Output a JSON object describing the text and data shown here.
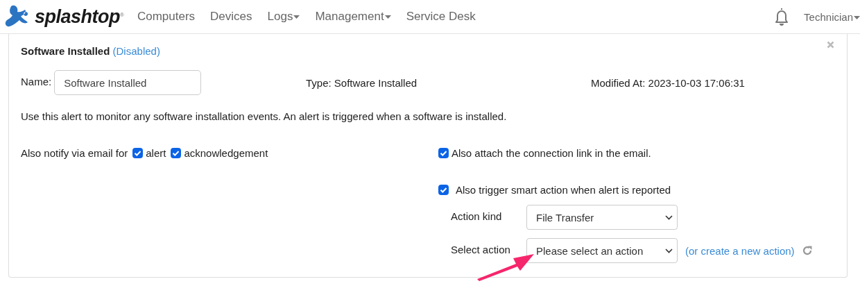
{
  "nav": {
    "logo": "splashtop",
    "logo_mark": "®",
    "items": [
      {
        "label": "Computers",
        "dropdown": false
      },
      {
        "label": "Devices",
        "dropdown": false
      },
      {
        "label": "Logs",
        "dropdown": true
      },
      {
        "label": "Management",
        "dropdown": true
      },
      {
        "label": "Service Desk",
        "dropdown": false
      }
    ],
    "user": "Technician"
  },
  "alert": {
    "title": "Software Installed",
    "status": "(Disabled)",
    "name_label": "Name:",
    "name_value": "Software Installed",
    "type": "Type: Software Installed",
    "modified": "Modified At: 2023-10-03 17:06:31",
    "description": "Use this alert to monitor any software installation events. An alert is triggered when a software is installed.",
    "notify_label": "Also notify via email for",
    "notify_options": [
      {
        "label": "alert",
        "checked": true
      },
      {
        "label": "acknowledgement",
        "checked": true
      }
    ],
    "attach_link": {
      "label": "Also attach the connection link in the email.",
      "checked": true
    },
    "smart_action": {
      "label": "Also trigger smart action when alert is reported",
      "checked": true,
      "action_kind_label": "Action kind",
      "action_kind": "File Transfer",
      "select_action_label": "Select action",
      "select_action_placeholder": "Please select an action",
      "create_link": "(or create a new action)"
    }
  }
}
